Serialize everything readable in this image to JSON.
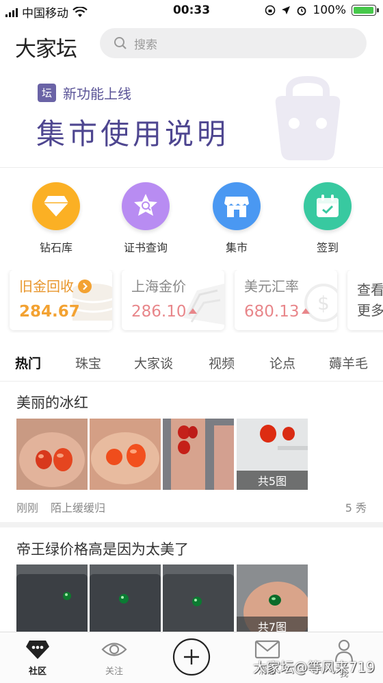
{
  "status": {
    "carrier": "中国移动",
    "time": "00:33",
    "battery": "100%",
    "battery_level": 1.0
  },
  "header": {
    "logo": "大家坛",
    "search_placeholder": "搜索"
  },
  "banner": {
    "tag_badge": "坛",
    "tag_text": "新功能上线",
    "title": "集市使用说明"
  },
  "shortcuts": [
    {
      "label": "钻石库",
      "icon": "diamond-icon",
      "color": "#fbb024"
    },
    {
      "label": "证书查询",
      "icon": "certificate-search-icon",
      "color": "#b88cf2"
    },
    {
      "label": "集市",
      "icon": "market-store-icon",
      "color": "#4a98f2"
    },
    {
      "label": "签到",
      "icon": "calendar-checkin-icon",
      "color": "#38c9a0"
    }
  ],
  "price_cards": [
    {
      "title": "旧金回收",
      "value": "284.67",
      "color": "#f3a232"
    },
    {
      "title": "上海金价",
      "value": "286.10",
      "color": "#e8868a"
    },
    {
      "title": "美元汇率",
      "value": "680.13",
      "color": "#e8868a"
    },
    {
      "title_line1": "查看",
      "title_line2": "更多"
    }
  ],
  "tabs": [
    "热门",
    "珠宝",
    "大家谈",
    "视频",
    "论点",
    "薅羊毛"
  ],
  "posts": [
    {
      "title": "美丽的冰红",
      "image_count": "共5图",
      "time": "刚刚",
      "author": "陌上缓缓归",
      "likes": "5 秀"
    },
    {
      "title": "帝王绿价格高是因为太美了",
      "image_count": "共7图"
    }
  ],
  "tabbar": [
    {
      "label": "社区",
      "icon": "community-icon"
    },
    {
      "label": "关注",
      "icon": "eye-icon"
    },
    {
      "label": "",
      "icon": "add-icon"
    },
    {
      "label": "消息",
      "icon": "mail-icon"
    },
    {
      "label": "我",
      "icon": "person-icon"
    }
  ],
  "watermark": "大家坛@等风来719"
}
